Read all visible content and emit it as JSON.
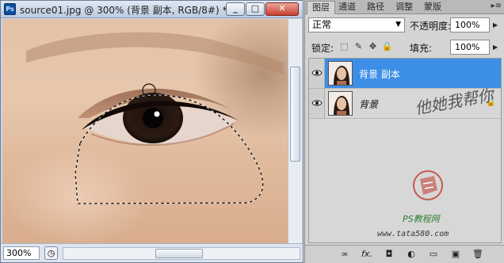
{
  "document": {
    "app_logo": "Ps",
    "title": "source01.jpg @ 300% (背景 副本, RGB/8#) *",
    "window_buttons": {
      "minimize": "_",
      "maximize": "□",
      "close": "✕"
    },
    "zoom": "300%",
    "status_icon": "navigator-icon"
  },
  "panel": {
    "tabs": [
      "图层",
      "通道",
      "路径",
      "调整",
      "蒙版"
    ],
    "active_tab": "图层",
    "blend_mode": "正常",
    "opacity_label": "不透明度:",
    "opacity_value": "100%",
    "lock_label": "锁定:",
    "fill_label": "填充:",
    "fill_value": "100%",
    "layers": [
      {
        "name": "背景 副本",
        "selected": true,
        "visible": true,
        "locked": false
      },
      {
        "name": "背景",
        "selected": false,
        "visible": true,
        "locked": true
      }
    ],
    "footer_icons": [
      "link-icon",
      "fx-icon",
      "mask-icon",
      "adjustment-icon",
      "group-icon",
      "new-layer-icon",
      "delete-icon"
    ],
    "footer_labels": {
      "link": "∞",
      "fx": "fx.",
      "mask": "◘",
      "adjust": "◐",
      "group": "▭",
      "new": "▣",
      "delete": "🗑"
    }
  },
  "watermark": {
    "text": "他她我帮你",
    "site_line1": "PS教程网",
    "site_line2": "www.tata580.com"
  },
  "colors": {
    "selection_blue": "#3d8ee6",
    "titlebar": "#c9d4e3",
    "watermark_red": "#c0392b"
  }
}
